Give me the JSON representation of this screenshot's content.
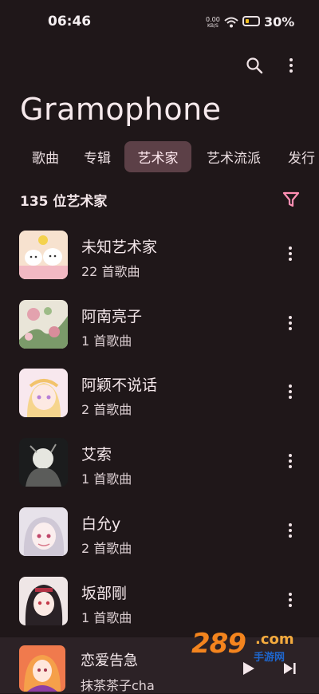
{
  "status_bar": {
    "time": "06:46",
    "net_speed_value": "0.00",
    "net_speed_unit": "KB/S",
    "battery_percent": "30%",
    "battery_level": 0.3
  },
  "app": {
    "title": "Gramophone"
  },
  "tabs": [
    {
      "label": "歌曲",
      "active": false
    },
    {
      "label": "专辑",
      "active": false
    },
    {
      "label": "艺术家",
      "active": true
    },
    {
      "label": "艺术流派",
      "active": false
    },
    {
      "label": "发行",
      "active": false
    }
  ],
  "list": {
    "count_label": "135 位艺术家",
    "artists": [
      {
        "name": "未知艺术家",
        "songs": "22 首歌曲"
      },
      {
        "name": "阿南亮子",
        "songs": "1 首歌曲"
      },
      {
        "name": "阿颖不说话",
        "songs": "2 首歌曲"
      },
      {
        "name": "艾索",
        "songs": "1 首歌曲"
      },
      {
        "name": "白允y",
        "songs": "2 首歌曲"
      },
      {
        "name": "坂部剛",
        "songs": "1 首歌曲"
      }
    ]
  },
  "now_playing": {
    "title": "恋爱告急",
    "artist": "抹茶茶子cha"
  },
  "watermark": {
    "number": "289",
    "domain": ".com",
    "site_name": "手游网"
  },
  "colors": {
    "background": "#1f1719",
    "accent": "#ff8fb3",
    "active_tab_bg": "#5c4047",
    "player_bg": "#2c2226"
  }
}
